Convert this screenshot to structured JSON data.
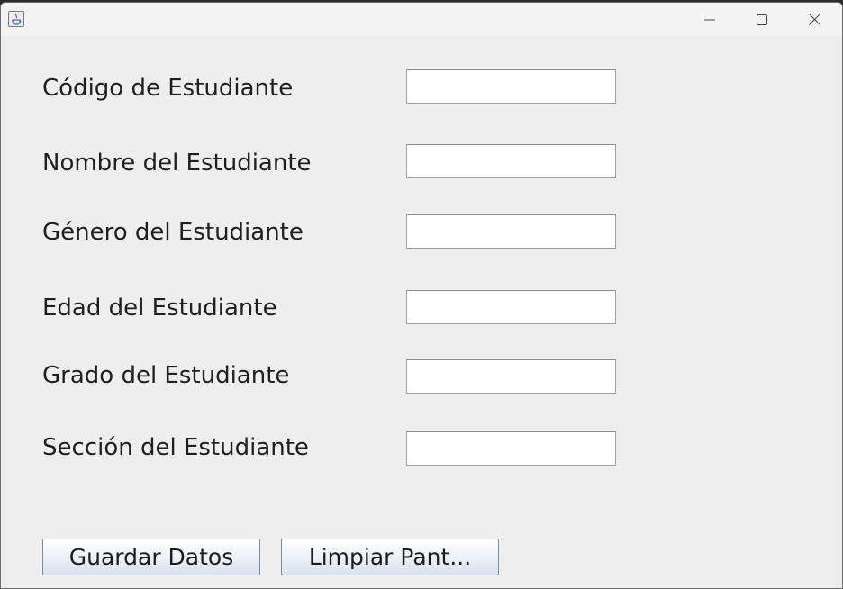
{
  "window": {
    "title": "",
    "controls": {
      "minimize": "minimize-icon",
      "maximize": "maximize-icon",
      "close": "close-icon"
    }
  },
  "form": {
    "fields": [
      {
        "label": "Código de Estudiante",
        "value": ""
      },
      {
        "label": "Nombre del Estudiante",
        "value": ""
      },
      {
        "label": "Género del Estudiante",
        "value": ""
      },
      {
        "label": "Edad del Estudiante",
        "value": ""
      },
      {
        "label": "Grado del Estudiante",
        "value": ""
      },
      {
        "label": "Sección del Estudiante",
        "value": ""
      }
    ]
  },
  "actions": {
    "save_label": "Guardar Datos",
    "clear_label": "Limpiar Pant..."
  },
  "colors": {
    "window_bg": "#eeeeee",
    "titlebar_bg": "#f3f3f3",
    "field_border": "#9c9fa4"
  }
}
